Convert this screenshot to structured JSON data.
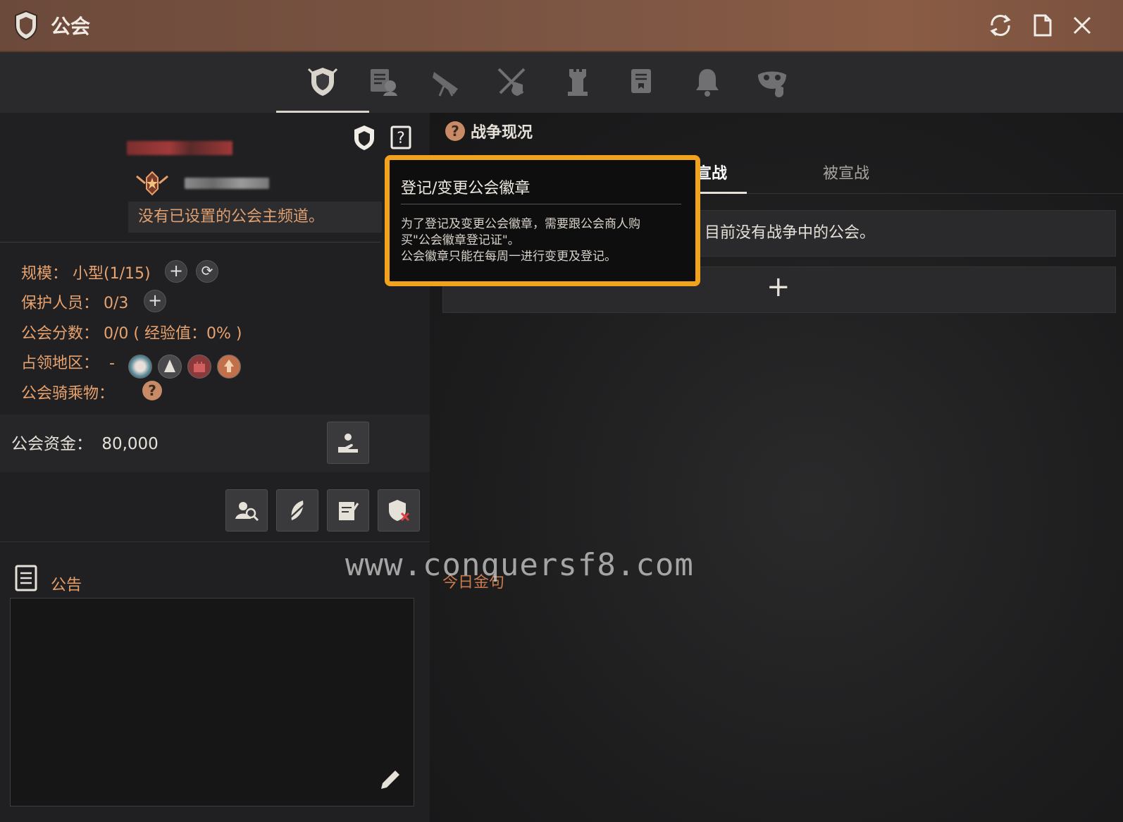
{
  "window": {
    "title": "公会",
    "refresh_icon": "refresh-icon",
    "doc_icon": "document-icon",
    "close_icon": "close-icon"
  },
  "tabs": [
    {
      "icon": "guild-emblem-icon",
      "active": true
    },
    {
      "icon": "member-list-icon",
      "active": false
    },
    {
      "icon": "telescope-icon",
      "active": false
    },
    {
      "icon": "crossed-swords-icon",
      "active": false
    },
    {
      "icon": "tower-icon",
      "active": false
    },
    {
      "icon": "scroll-icon",
      "active": false
    },
    {
      "icon": "bell-icon",
      "active": false
    },
    {
      "icon": "mask-icon",
      "active": false
    }
  ],
  "guild": {
    "channel_text": "没有已设置的公会主频道。",
    "stats": {
      "scale_label": "规模：",
      "scale_value": "小型(1/15)",
      "protector_label": "保护人员：",
      "protector_value": "0/3",
      "score_label": "公会分数：",
      "score_value": "0/0 ( 经验值：0% )",
      "territory_label": "占领地区：",
      "territory_value": "-",
      "mount_label": "公会骑乘物：",
      "mount_help": "?"
    },
    "funds_label": "公会资金：",
    "funds_value": "80,000",
    "notice_label": "公告"
  },
  "war": {
    "title": "战争现况",
    "help": "?",
    "tabs": [
      "已宣战",
      "被宣战"
    ],
    "empty_text": "目前没有战争中的公会。",
    "add": "+",
    "today_label": "今日金句"
  },
  "tooltip": {
    "title": "登记/变更公会徽章",
    "line1": "为了登记及变更公会徽章，需要跟公会商人购",
    "line2": "买\"公会徽章登记证\"。",
    "line3": "公会徽章只能在每周一进行变更及登记。"
  },
  "watermark": "www.conquersf8.com",
  "colors": {
    "accent_orange": "#e8a26e",
    "tooltip_border": "#f2a31e",
    "titlebar": "#7e5644"
  }
}
